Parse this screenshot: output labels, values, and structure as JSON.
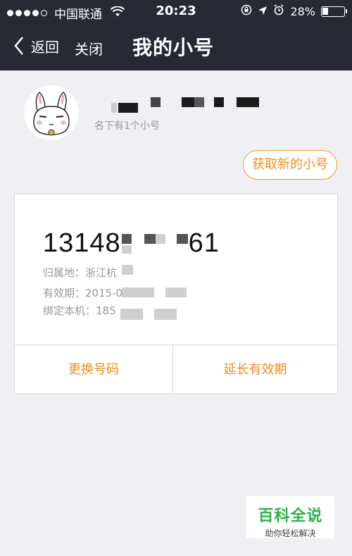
{
  "status_bar": {
    "carrier": "中国联通",
    "time": "20:23",
    "battery": "28%",
    "battery_level": 0.28,
    "signal_bars": 5,
    "signal_filled": 4
  },
  "nav": {
    "back_label": "返回",
    "close_label": "关闭",
    "title": "我的小号"
  },
  "profile": {
    "sub_text": "名下有1个小号"
  },
  "get_new_button": "获取新的小号",
  "card": {
    "number_visible": "13148",
    "number_tail": "61",
    "location_label": "归属地：浙江杭",
    "validity_label": "有效期：2015-0",
    "bind_label": "绑定本机：185"
  },
  "actions": {
    "change_number": "更换号码",
    "extend_validity": "延长有效期"
  },
  "watermark": {
    "title": "百科全说",
    "subtitle": "助你轻松解决"
  },
  "colors": {
    "nav_bg": "#272a33",
    "accent": "#f08e1b",
    "page_bg": "#efeff4"
  }
}
